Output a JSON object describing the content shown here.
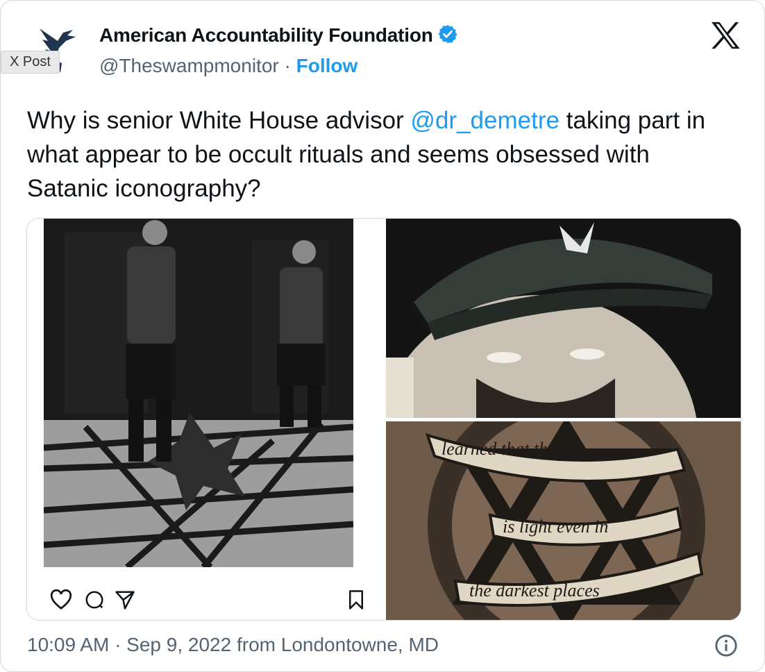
{
  "tag_label": "X Post",
  "account": {
    "name": "American Accountability Foundation",
    "handle": "@Theswampmonitor",
    "separator": "·",
    "follow_label": "Follow",
    "verified_color": "#1d9bf0"
  },
  "tweet": {
    "text_before": "Why is senior White House advisor ",
    "mention": "@dr_demetre",
    "text_after": " taking part in what appear to be occult rituals and seems obsessed with Satanic iconography?"
  },
  "media": {
    "tattoo_lines": [
      "learned that there",
      "is light even in",
      "the darkest places"
    ]
  },
  "footer": {
    "timestamp": "10:09 AM · Sep 9, 2022 from Londontowne, MD"
  },
  "icons": {
    "x_logo": "x-logo-icon",
    "info": "info-icon",
    "heart": "heart-icon",
    "comment": "comment-icon",
    "share": "share-icon",
    "bookmark": "bookmark-icon"
  }
}
